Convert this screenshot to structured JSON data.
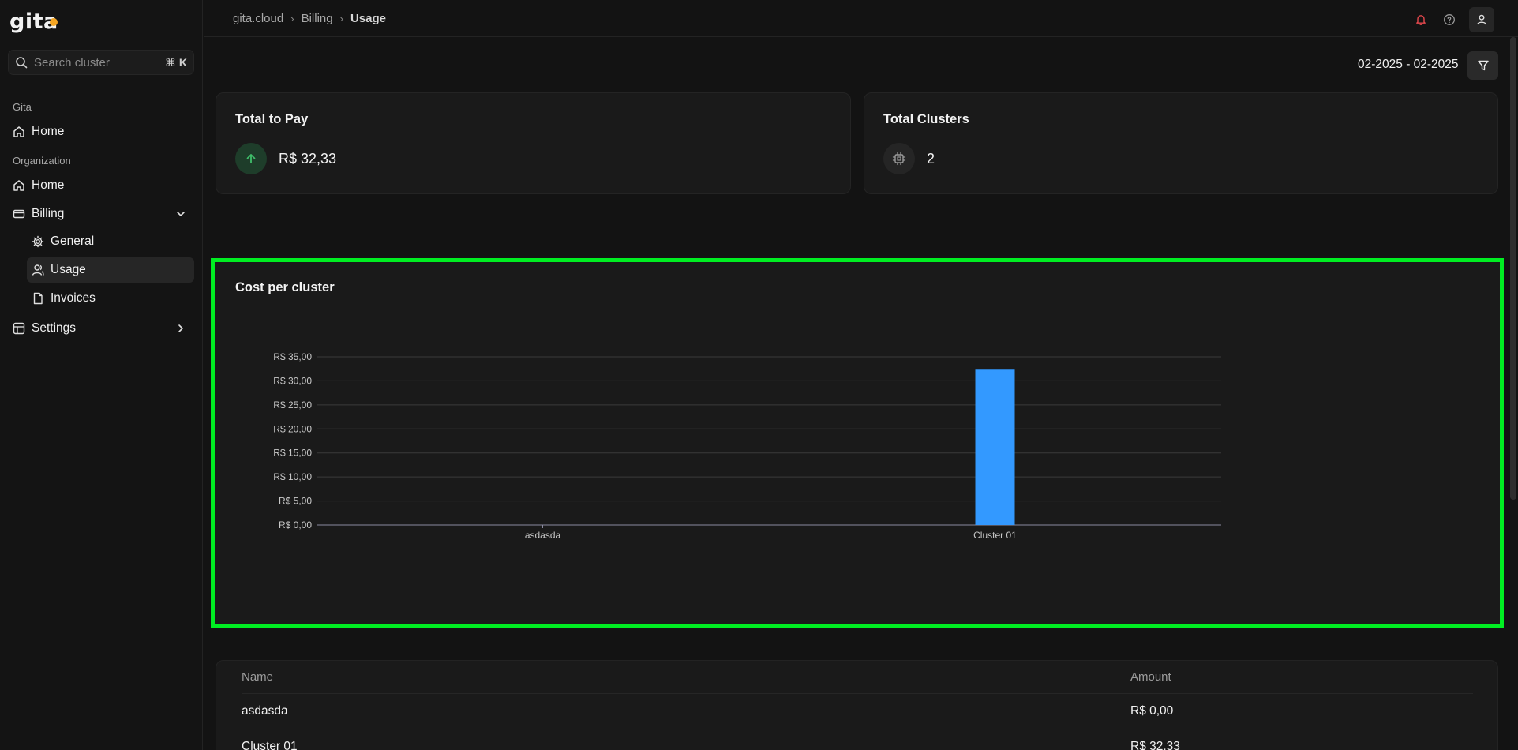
{
  "app": {
    "logo": "gita"
  },
  "search": {
    "placeholder": "Search cluster",
    "shortcut_symbol": "⌘",
    "shortcut_key": "K"
  },
  "sidebar": {
    "section_gita": "Gita",
    "gita_home": "Home",
    "section_org": "Organization",
    "org_home": "Home",
    "billing": "Billing",
    "billing_general": "General",
    "billing_usage": "Usage",
    "billing_invoices": "Invoices",
    "settings": "Settings"
  },
  "breadcrumb": {
    "root": "gita.cloud",
    "parent": "Billing",
    "current": "Usage"
  },
  "filter": {
    "date_range": "02-2025 - 02-2025"
  },
  "stats": {
    "total_to_pay": {
      "title": "Total to Pay",
      "value": "R$ 32,33"
    },
    "total_clusters": {
      "title": "Total Clusters",
      "value": "2"
    }
  },
  "chart": {
    "title": "Cost per cluster"
  },
  "chart_data": {
    "type": "bar",
    "title": "Cost per cluster",
    "categories": [
      "asdasda",
      "Cluster 01"
    ],
    "values": [
      0,
      32.33
    ],
    "ylim": [
      0,
      35
    ],
    "yticks": [
      0,
      5,
      10,
      15,
      20,
      25,
      30,
      35
    ],
    "ytick_labels": [
      "R$ 0,00",
      "R$ 5,00",
      "R$ 10,00",
      "R$ 15,00",
      "R$ 20,00",
      "R$ 25,00",
      "R$ 30,00",
      "R$ 35,00"
    ],
    "bar_color": "#3399ff",
    "grid": true
  },
  "table": {
    "headers": {
      "name": "Name",
      "amount": "Amount"
    },
    "rows": [
      {
        "name": "asdasda",
        "amount": "R$ 0,00"
      },
      {
        "name": "Cluster 01",
        "amount": "R$ 32,33"
      }
    ]
  },
  "colors": {
    "accent_green": "#00ee22",
    "bar_blue": "#3399ff",
    "bell_red": "#e5484d",
    "positive_green": "#3fbf6a"
  }
}
